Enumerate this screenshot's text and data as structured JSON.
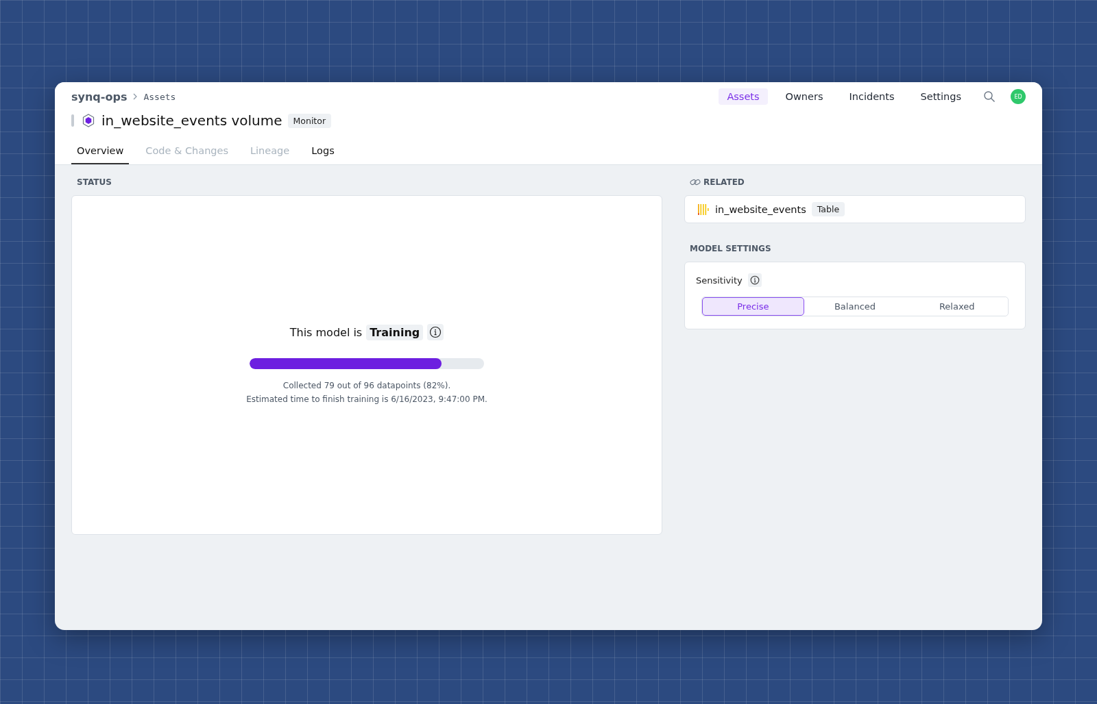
{
  "breadcrumb": {
    "org": "synq-ops",
    "section": "Assets"
  },
  "nav": [
    {
      "label": "Assets",
      "selected": true
    },
    {
      "label": "Owners",
      "selected": false
    },
    {
      "label": "Incidents",
      "selected": false
    },
    {
      "label": "Settings",
      "selected": false
    }
  ],
  "avatar": {
    "initials": "ED"
  },
  "title": {
    "text": "in_website_events volume",
    "badge": "Monitor"
  },
  "tabs": [
    {
      "label": "Overview",
      "selected": true,
      "disabled": false
    },
    {
      "label": "Code & Changes",
      "selected": false,
      "disabled": true
    },
    {
      "label": "Lineage",
      "selected": false,
      "disabled": true
    },
    {
      "label": "Logs",
      "selected": false,
      "disabled": false
    }
  ],
  "status": {
    "heading": "STATUS",
    "prefix": "This model is",
    "state": "Training",
    "level": 0.82,
    "lines": [
      "Collected 79 out of 96 datapoints (82%).",
      "Estimated time to finish training is 6/16/2023, 9:47:00 PM."
    ]
  },
  "related": {
    "heading": "RELATED",
    "items": [
      {
        "name": "in_website_events",
        "badge": "Table"
      }
    ]
  },
  "model_settings": {
    "heading": "MODEL SETTINGS",
    "label": "Sensitivity",
    "options": [
      {
        "label": "Precise",
        "selected": true
      },
      {
        "label": "Balanced",
        "selected": false
      },
      {
        "label": "Relaxed",
        "selected": false
      }
    ]
  }
}
